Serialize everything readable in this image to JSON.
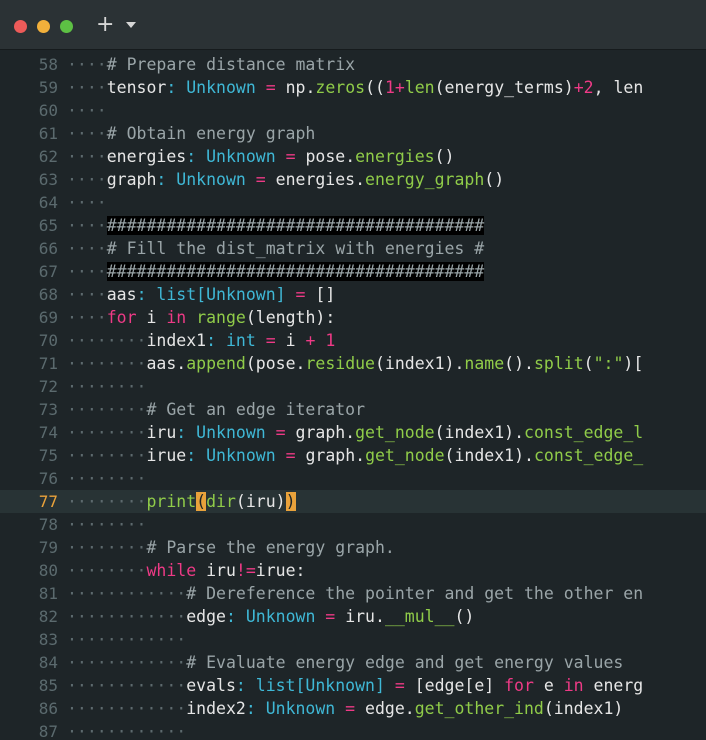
{
  "window": {
    "traffic_lights": [
      {
        "name": "close",
        "color": "#ed5b59"
      },
      {
        "name": "minimize",
        "color": "#f2b03b"
      },
      {
        "name": "zoom",
        "color": "#5dc044"
      }
    ],
    "new_tab_glyph": "+"
  },
  "editor": {
    "current_line": 77,
    "lines": [
      {
        "number": "58",
        "tokens": [
          [
            "ws",
            "····"
          ],
          [
            "cm",
            "# Prepare distance matrix"
          ]
        ]
      },
      {
        "number": "59",
        "tokens": [
          [
            "ws",
            "····"
          ],
          [
            "",
            "tensor"
          ],
          [
            "ty",
            ": Unknown"
          ],
          [
            "op",
            " = "
          ],
          [
            "",
            "np."
          ],
          [
            "fn",
            "zeros"
          ],
          [
            "",
            "(("
          ],
          [
            "num",
            "1"
          ],
          [
            "op",
            "+"
          ],
          [
            "fn",
            "len"
          ],
          [
            "",
            "(energy_terms)"
          ],
          [
            "op",
            "+"
          ],
          [
            "num",
            "2"
          ],
          [
            "",
            ", len"
          ]
        ]
      },
      {
        "number": "60",
        "tokens": [
          [
            "ws",
            "····"
          ]
        ]
      },
      {
        "number": "61",
        "tokens": [
          [
            "ws",
            "····"
          ],
          [
            "cm",
            "# Obtain energy graph"
          ]
        ]
      },
      {
        "number": "62",
        "tokens": [
          [
            "ws",
            "····"
          ],
          [
            "",
            "energies"
          ],
          [
            "ty",
            ": Unknown"
          ],
          [
            "op",
            " = "
          ],
          [
            "",
            "pose."
          ],
          [
            "fn",
            "energies"
          ],
          [
            "",
            "()"
          ]
        ]
      },
      {
        "number": "63",
        "tokens": [
          [
            "ws",
            "····"
          ],
          [
            "",
            "graph"
          ],
          [
            "ty",
            ": Unknown"
          ],
          [
            "op",
            " = "
          ],
          [
            "",
            "energies."
          ],
          [
            "fn",
            "energy_graph"
          ],
          [
            "",
            "()"
          ]
        ]
      },
      {
        "number": "64",
        "tokens": [
          [
            "ws",
            "····"
          ]
        ]
      },
      {
        "number": "65",
        "highlight": true,
        "tokens": [
          [
            "ws",
            "····"
          ],
          [
            "cm",
            "######################################"
          ]
        ]
      },
      {
        "number": "66",
        "tokens": [
          [
            "ws",
            "····"
          ],
          [
            "cm",
            "# Fill the dist_matrix with energies #"
          ]
        ]
      },
      {
        "number": "67",
        "highlight": true,
        "tokens": [
          [
            "ws",
            "····"
          ],
          [
            "cm",
            "######################################"
          ]
        ]
      },
      {
        "number": "68",
        "tokens": [
          [
            "ws",
            "····"
          ],
          [
            "",
            "aas"
          ],
          [
            "ty",
            ": list[Unknown]"
          ],
          [
            "op",
            " = "
          ],
          [
            "",
            "[]"
          ]
        ]
      },
      {
        "number": "69",
        "tokens": [
          [
            "ws",
            "····"
          ],
          [
            "kw",
            "for"
          ],
          [
            "",
            " i "
          ],
          [
            "kw",
            "in"
          ],
          [
            "",
            " "
          ],
          [
            "fn",
            "range"
          ],
          [
            "",
            "(length):"
          ]
        ]
      },
      {
        "number": "70",
        "tokens": [
          [
            "ws",
            "········"
          ],
          [
            "",
            "index1"
          ],
          [
            "ty",
            ": int"
          ],
          [
            "op",
            " = "
          ],
          [
            "",
            "i "
          ],
          [
            "op",
            "+"
          ],
          [
            "",
            " "
          ],
          [
            "num",
            "1"
          ]
        ]
      },
      {
        "number": "71",
        "tokens": [
          [
            "ws",
            "········"
          ],
          [
            "",
            "aas."
          ],
          [
            "fn",
            "append"
          ],
          [
            "",
            "(pose."
          ],
          [
            "fn",
            "residue"
          ],
          [
            "",
            "(index1)."
          ],
          [
            "fn",
            "name"
          ],
          [
            "",
            "()."
          ],
          [
            "fn",
            "split"
          ],
          [
            "",
            "("
          ],
          [
            "st",
            "\":\""
          ],
          [
            "",
            ")["
          ]
        ]
      },
      {
        "number": "72",
        "tokens": [
          [
            "ws",
            "········"
          ]
        ]
      },
      {
        "number": "73",
        "tokens": [
          [
            "ws",
            "········"
          ],
          [
            "cm",
            "# Get an edge iterator"
          ]
        ]
      },
      {
        "number": "74",
        "tokens": [
          [
            "ws",
            "········"
          ],
          [
            "",
            "iru"
          ],
          [
            "ty",
            ": Unknown"
          ],
          [
            "op",
            " = "
          ],
          [
            "",
            "graph."
          ],
          [
            "fn",
            "get_node"
          ],
          [
            "",
            "(index1)."
          ],
          [
            "fn",
            "const_edge_l"
          ]
        ]
      },
      {
        "number": "75",
        "tokens": [
          [
            "ws",
            "········"
          ],
          [
            "",
            "irue"
          ],
          [
            "ty",
            ": Unknown"
          ],
          [
            "op",
            " = "
          ],
          [
            "",
            "graph."
          ],
          [
            "fn",
            "get_node"
          ],
          [
            "",
            "(index1)."
          ],
          [
            "fn",
            "const_edge_"
          ]
        ]
      },
      {
        "number": "76",
        "tokens": [
          [
            "ws",
            "········"
          ]
        ]
      },
      {
        "number": "77",
        "current": true,
        "tokens": [
          [
            "ws",
            "········"
          ],
          [
            "fn",
            "print"
          ],
          [
            "br",
            "("
          ],
          [
            "fn",
            "dir"
          ],
          [
            "",
            "(iru)"
          ],
          [
            "br",
            ")"
          ]
        ]
      },
      {
        "number": "78",
        "tokens": [
          [
            "ws",
            "········"
          ]
        ]
      },
      {
        "number": "79",
        "tokens": [
          [
            "ws",
            "········"
          ],
          [
            "cm",
            "# Parse the energy graph."
          ]
        ]
      },
      {
        "number": "80",
        "tokens": [
          [
            "ws",
            "········"
          ],
          [
            "kw",
            "while"
          ],
          [
            "",
            " iru"
          ],
          [
            "op",
            "!="
          ],
          [
            "",
            "irue:"
          ]
        ]
      },
      {
        "number": "81",
        "tokens": [
          [
            "ws",
            "············"
          ],
          [
            "cm",
            "# Dereference the pointer and get the other en"
          ]
        ]
      },
      {
        "number": "82",
        "tokens": [
          [
            "ws",
            "············"
          ],
          [
            "",
            "edge"
          ],
          [
            "ty",
            ": Unknown"
          ],
          [
            "op",
            " = "
          ],
          [
            "",
            "iru."
          ],
          [
            "fn",
            "__mul__"
          ],
          [
            "",
            "()"
          ]
        ]
      },
      {
        "number": "83",
        "tokens": [
          [
            "ws",
            "············"
          ]
        ]
      },
      {
        "number": "84",
        "tokens": [
          [
            "ws",
            "············"
          ],
          [
            "cm",
            "# Evaluate energy edge and get energy values"
          ]
        ]
      },
      {
        "number": "85",
        "tokens": [
          [
            "ws",
            "············"
          ],
          [
            "",
            "evals"
          ],
          [
            "ty",
            ": list[Unknown]"
          ],
          [
            "op",
            " = "
          ],
          [
            "",
            "[edge[e] "
          ],
          [
            "kw",
            "for"
          ],
          [
            "",
            " e "
          ],
          [
            "kw",
            "in"
          ],
          [
            "",
            " energ"
          ]
        ]
      },
      {
        "number": "86",
        "tokens": [
          [
            "ws",
            "············"
          ],
          [
            "",
            "index2"
          ],
          [
            "ty",
            ": Unknown"
          ],
          [
            "op",
            " = "
          ],
          [
            "",
            "edge."
          ],
          [
            "fn",
            "get_other_ind"
          ],
          [
            "",
            "(index1)"
          ]
        ]
      },
      {
        "number": "87",
        "tokens": [
          [
            "ws",
            "············"
          ]
        ]
      }
    ]
  }
}
